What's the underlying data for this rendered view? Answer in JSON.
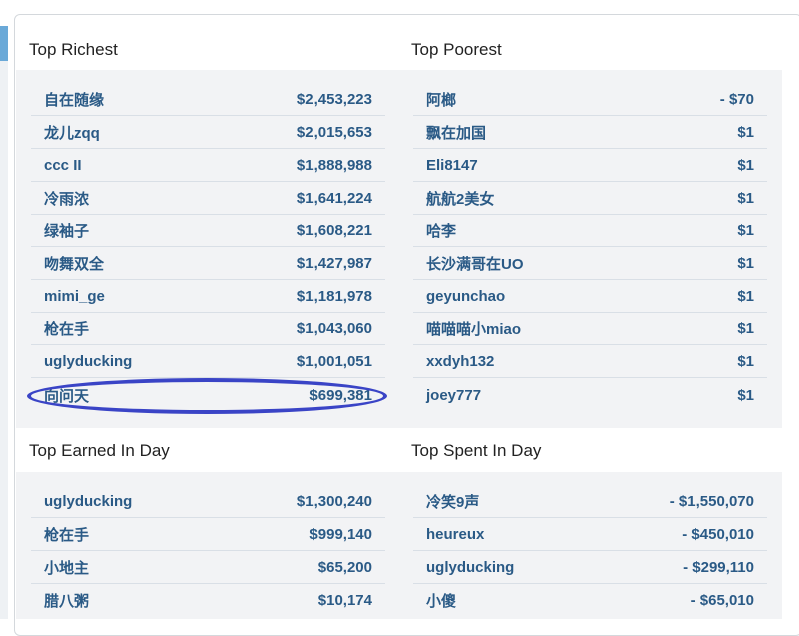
{
  "sections": {
    "top_richest": {
      "title": "Top Richest",
      "rows": [
        {
          "name": "自在随缘",
          "value": "$2,453,223"
        },
        {
          "name": "龙儿zqq",
          "value": "$2,015,653"
        },
        {
          "name": "ccc II",
          "value": "$1,888,988"
        },
        {
          "name": "冷雨浓",
          "value": "$1,641,224"
        },
        {
          "name": "绿袖子",
          "value": "$1,608,221"
        },
        {
          "name": "吻舞双全",
          "value": "$1,427,987"
        },
        {
          "name": "mimi_ge",
          "value": "$1,181,978"
        },
        {
          "name": "枪在手",
          "value": "$1,043,060"
        },
        {
          "name": "uglyducking",
          "value": "$1,001,051"
        },
        {
          "name": "向问天",
          "value": "$699,381"
        }
      ]
    },
    "top_poorest": {
      "title": "Top Poorest",
      "rows": [
        {
          "name": "阿榔",
          "value": "- $70"
        },
        {
          "name": "飘在加国",
          "value": "$1"
        },
        {
          "name": "Eli8147",
          "value": "$1"
        },
        {
          "name": "航航2美女",
          "value": "$1"
        },
        {
          "name": "哈李",
          "value": "$1"
        },
        {
          "name": "长沙满哥在UO",
          "value": "$1"
        },
        {
          "name": "geyunchao",
          "value": "$1"
        },
        {
          "name": "喵喵喵小miao",
          "value": "$1"
        },
        {
          "name": "xxdyh132",
          "value": "$1"
        },
        {
          "name": "joey777",
          "value": "$1"
        }
      ]
    },
    "top_earned_in_day": {
      "title": "Top Earned In Day",
      "rows": [
        {
          "name": "uglyducking",
          "value": "$1,300,240"
        },
        {
          "name": "枪在手",
          "value": "$999,140"
        },
        {
          "name": "小地主",
          "value": "$65,200"
        },
        {
          "name": "腊八粥",
          "value": "$10,174"
        }
      ]
    },
    "top_spent_in_day": {
      "title": "Top Spent In Day",
      "rows": [
        {
          "name": "冷笑9声",
          "value": "- $1,550,070"
        },
        {
          "name": "heureux",
          "value": "- $450,010"
        },
        {
          "name": "uglyducking",
          "value": "- $299,110"
        },
        {
          "name": "小傻",
          "value": "- $65,010"
        }
      ]
    }
  },
  "colors": {
    "link_text": "#2a5a86",
    "row_background": "#f2f3f5",
    "highlight_annotation": "#3a44c6"
  }
}
